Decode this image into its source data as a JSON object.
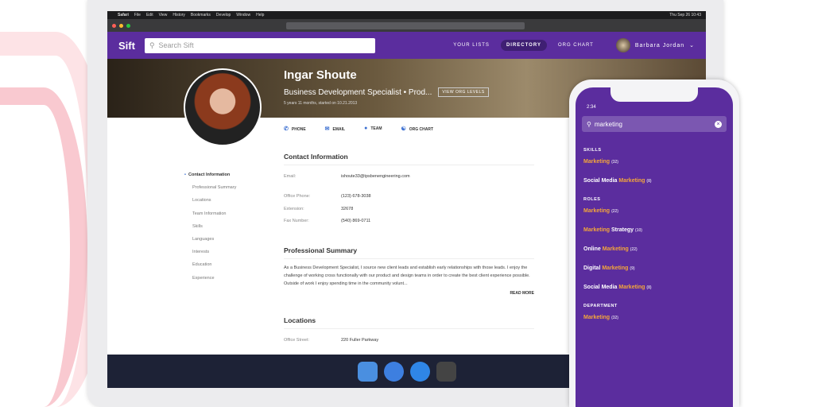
{
  "menubar": {
    "app": "Safari",
    "items": [
      "File",
      "Edit",
      "View",
      "History",
      "Bookmarks",
      "Develop",
      "Window",
      "Help"
    ],
    "clock": "Thu Sep 26 10:43"
  },
  "app": {
    "logo": "Sift",
    "search_placeholder": "Search Sift",
    "nav": [
      "YOUR LISTS",
      "DIRECTORY",
      "ORG CHART"
    ],
    "user": "Barbara Jordan"
  },
  "profile": {
    "name": "Ingar Shoute",
    "title": "Business Development Specialist • Prod...",
    "view_org": "VIEW ORG LEVELS",
    "tenure": "5 years 11 months, started on 10.21.2013",
    "actions": [
      "PHONE",
      "EMAIL",
      "TEAM",
      "ORG CHART"
    ]
  },
  "sidebar": [
    "Contact Information",
    "Professional Summary",
    "Locations",
    "Team Information",
    "Skills",
    "Languages",
    "Interests",
    "Education",
    "Experience"
  ],
  "contact": {
    "heading": "Contact Information",
    "rows": [
      {
        "k": "Email:",
        "v": "ishoute33@tpsbenengineering.com"
      },
      {
        "k": "Office Phone:",
        "v": "(123) 678-3038"
      },
      {
        "k": "Extension:",
        "v": "32678"
      },
      {
        "k": "Fax Number:",
        "v": "(540) 869-0711"
      }
    ]
  },
  "summary": {
    "heading": "Professional Summary",
    "text": "As a Business Development Specialist, I source new client leads and establish early relationships with those leads. I enjoy the challenge of working cross functionally with our product and design teams in order to create the best client experience possible. Outside of work I enjoy spending time in the community volunt...",
    "more": "READ MORE"
  },
  "locations": {
    "heading": "Locations",
    "row": {
      "k": "Office Street:",
      "v": "220 Fuller Parkway"
    }
  },
  "phone": {
    "time": "2:34",
    "query": "marketing",
    "sections": [
      {
        "h": "SKILLS",
        "items": [
          {
            "pre": "",
            "hl": "Marketing",
            "post": "",
            "c": "(32)"
          },
          {
            "pre": "Social Media ",
            "hl": "Marketing",
            "post": "",
            "c": "(8)"
          }
        ]
      },
      {
        "h": "ROLES",
        "items": [
          {
            "pre": "",
            "hl": "Marketing",
            "post": "",
            "c": "(22)"
          },
          {
            "pre": "",
            "hl": "Marketing",
            "post": " Strategy",
            "c": "(10)"
          },
          {
            "pre": "Online ",
            "hl": "Marketing",
            "post": "",
            "c": "(22)"
          },
          {
            "pre": "Digital ",
            "hl": "Marketing",
            "post": "",
            "c": "(9)"
          },
          {
            "pre": "Social Media ",
            "hl": "Marketing",
            "post": "",
            "c": "(8)"
          }
        ]
      },
      {
        "h": "DEPARTMENT",
        "items": [
          {
            "pre": "",
            "hl": "Marketing",
            "post": "",
            "c": "(32)"
          }
        ]
      }
    ]
  }
}
